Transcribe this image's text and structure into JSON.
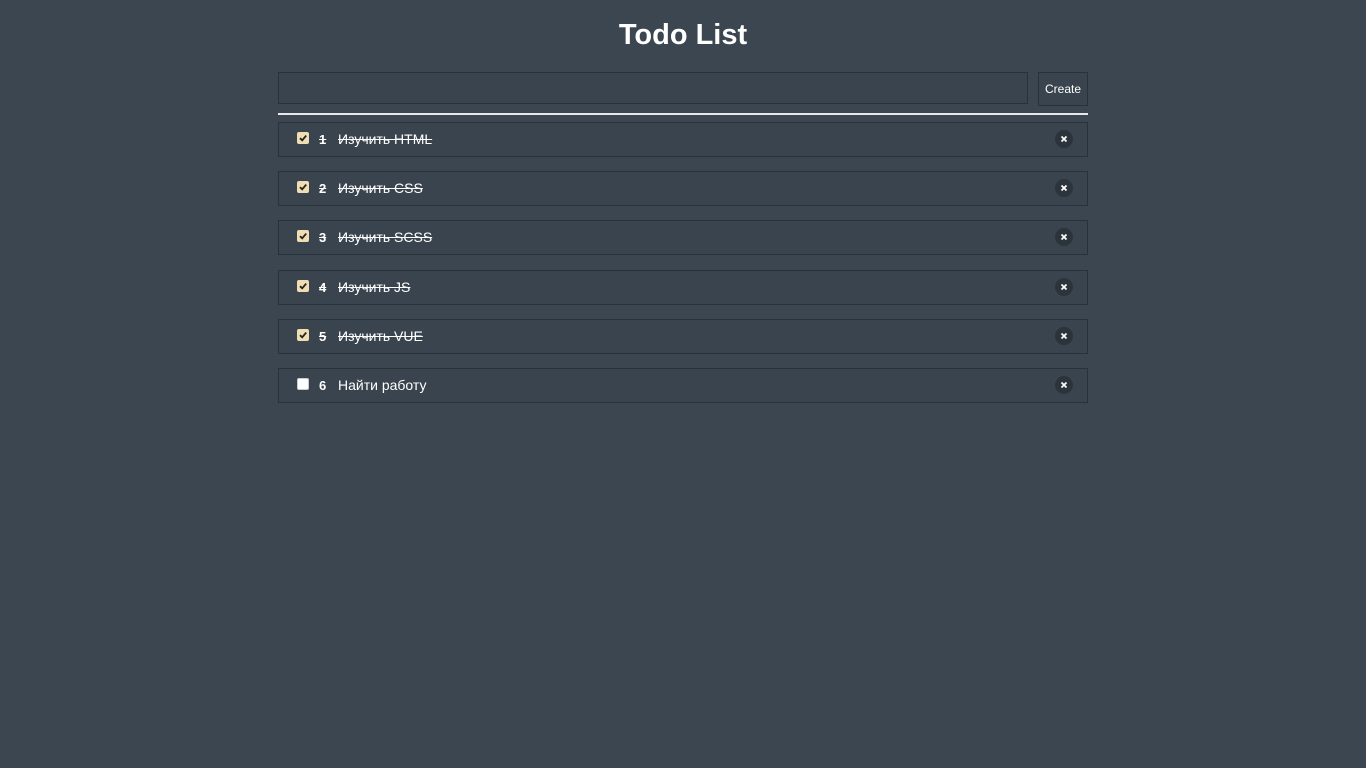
{
  "header": {
    "title": "Todo List"
  },
  "create": {
    "input_value": "",
    "input_placeholder": "",
    "button_label": "Create"
  },
  "todos": [
    {
      "number": "1",
      "text": "Изучить HTML",
      "done": true
    },
    {
      "number": "2",
      "text": "Изучить CSS",
      "done": true
    },
    {
      "number": "3",
      "text": "Изучить SCSS",
      "done": true
    },
    {
      "number": "4",
      "text": "Изучить JS",
      "done": true
    },
    {
      "number": "5",
      "text": "Изучить VUE",
      "done": true
    },
    {
      "number": "6",
      "text": "Найти работу",
      "done": false
    }
  ],
  "icons": {
    "checkbox_checked": "check-icon",
    "remove": "close-icon"
  },
  "colors": {
    "background": "#3b4650",
    "checked_box": "#f1ddb4",
    "divider": "#e6e8ea"
  }
}
